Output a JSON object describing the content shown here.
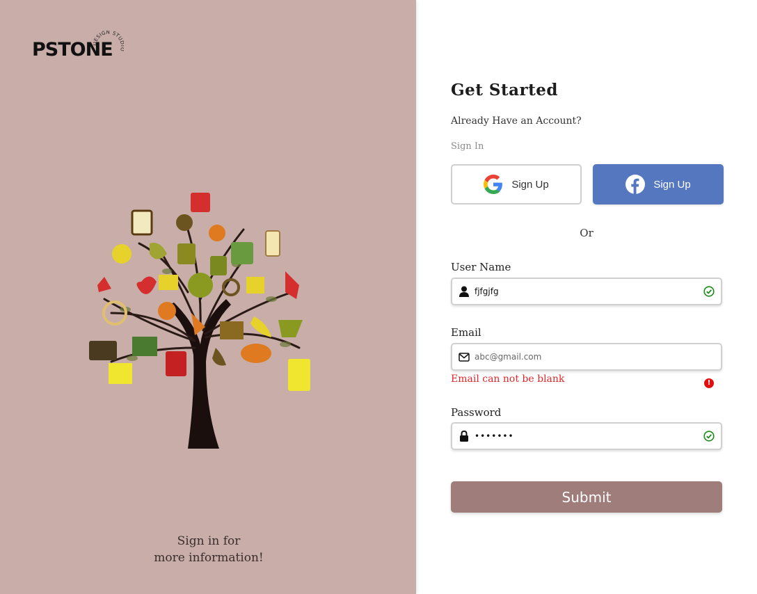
{
  "brand": {
    "logo_text": "PSTONE",
    "logo_ring_text": "DESIGN STUDIO"
  },
  "hero": {
    "tagline_line1": "Sign in for",
    "tagline_line2": "more information!"
  },
  "form": {
    "title": "Get Started",
    "already_text": "Already Have an Account?",
    "signin_link": "Sign In",
    "google_button": "Sign Up",
    "facebook_button": "Sign Up",
    "or_text": "Or",
    "username": {
      "label": "User Name",
      "value": "fjfgjfg",
      "status": "valid"
    },
    "email": {
      "label": "Email",
      "value": "",
      "placeholder": "abc@gmail.com",
      "error": "Email can not be blank",
      "status": "error"
    },
    "password": {
      "label": "Password",
      "value": "•••••••",
      "status": "valid"
    },
    "submit_label": "Submit"
  },
  "colors": {
    "left_panel": "#c8ada8",
    "facebook": "#5577bf",
    "submit": "#9e7d7a",
    "error": "#e0262a",
    "valid": "#1a8a1a"
  },
  "icons": [
    "google-icon",
    "facebook-icon",
    "user-icon",
    "envelope-icon",
    "lock-icon",
    "check-circle-icon",
    "error-icon",
    "tree-illustration"
  ]
}
